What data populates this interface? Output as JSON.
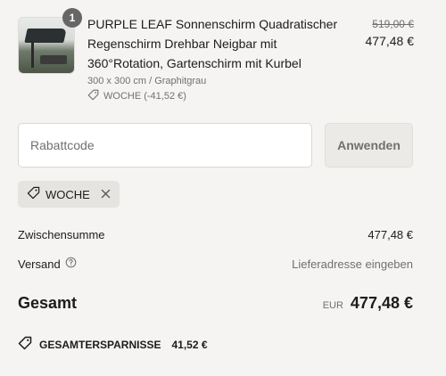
{
  "product": {
    "quantity_badge": "1",
    "title": "PURPLE LEAF Sonnenschirm Quadratischer Regenschirm Drehbar Neigbar mit 360°Rotation, Gartenschirm mit Kurbel",
    "variant": "300 x 300 cm / Graphitgrau",
    "discount_label": "WOCHE (-41,52 €)",
    "price_original": "519,00 €",
    "price_final": "477,48 €",
    "thumbnail_icon": "product-thumbnail"
  },
  "discount": {
    "placeholder": "Rabattcode",
    "value": "",
    "apply_label": "Anwenden",
    "applied_code": "WOCHE"
  },
  "summary": {
    "subtotal_label": "Zwischensumme",
    "subtotal_value": "477,48 €",
    "shipping_label": "Versand",
    "shipping_value": "Lieferadresse eingeben",
    "total_label": "Gesamt",
    "total_currency": "EUR",
    "total_value": "477,48 €",
    "savings_label": "GESAMTERSPARNISSE",
    "savings_value": "41,52 €"
  },
  "colors": {
    "background": "#f5f4f2",
    "text": "#1c1c1c",
    "muted": "#707070",
    "badge": "#666666"
  }
}
